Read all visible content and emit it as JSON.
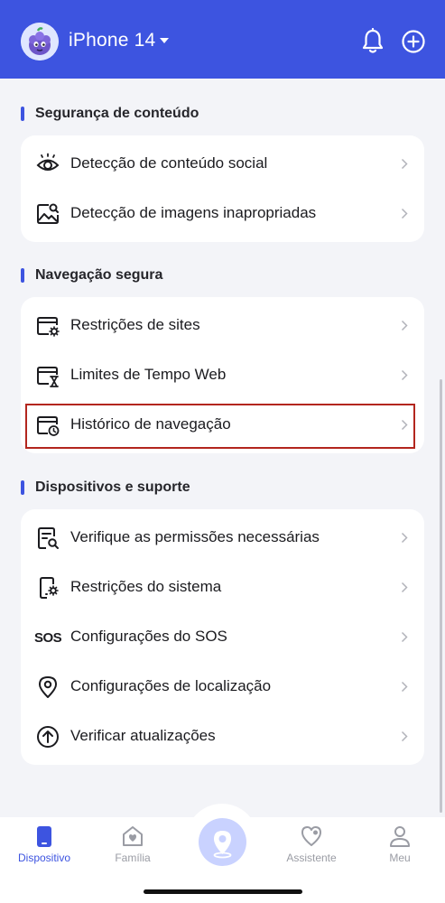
{
  "header": {
    "device_name": "iPhone 14",
    "device_caret_icon": "caret-down-icon",
    "notifications_icon": "bell-icon",
    "add_icon": "plus-circle-icon",
    "background_color": "#3d54e0"
  },
  "sections": [
    {
      "title": "Segurança de conteúdo",
      "items": [
        {
          "label": "Detecção de conteúdo social",
          "icon": "eye-icon"
        },
        {
          "label": "Detecção de imagens inapropriadas",
          "icon": "image-search-icon"
        }
      ]
    },
    {
      "title": "Navegação segura",
      "items": [
        {
          "label": "Restrições de sites",
          "icon": "browser-settings-icon"
        },
        {
          "label": "Limites de Tempo Web",
          "icon": "browser-hourglass-icon"
        },
        {
          "label": "Histórico de navegação",
          "icon": "browser-history-icon"
        }
      ]
    },
    {
      "title": "Dispositivos e suporte",
      "items": [
        {
          "label": "Verifique as permissões necessárias",
          "icon": "document-search-icon"
        },
        {
          "label": "Restrições do sistema",
          "icon": "phone-settings-icon"
        },
        {
          "label": "Configurações do SOS",
          "icon": "sos-icon",
          "icon_text": "SOS"
        },
        {
          "label": "Configurações de localização",
          "icon": "location-pin-icon"
        },
        {
          "label": "Verificar atualizações",
          "icon": "arrow-up-circle-icon"
        }
      ]
    }
  ],
  "tabbar": {
    "tabs": [
      {
        "label": "Dispositivo",
        "icon": "phone-icon",
        "active": true
      },
      {
        "label": "Família",
        "icon": "family-heart-icon",
        "active": false
      },
      {
        "label": "",
        "icon": "location-center-icon",
        "active": false
      },
      {
        "label": "Assistente",
        "icon": "heart-assistant-icon",
        "active": false
      },
      {
        "label": "Meu",
        "icon": "user-icon",
        "active": false
      }
    ],
    "active_color": "#3d54e0",
    "inactive_color": "#9a9ca4"
  }
}
